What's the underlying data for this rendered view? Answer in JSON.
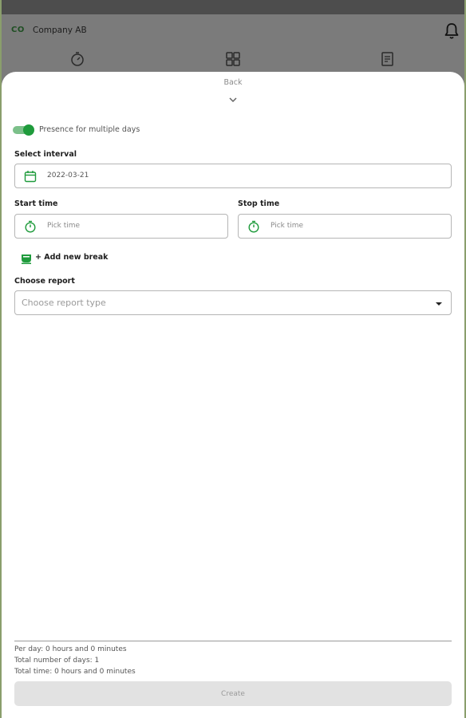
{
  "header": {
    "company_initials": "CO",
    "company_name": "Company AB",
    "nav_icons": [
      "stopwatch-icon",
      "grid-icon",
      "report-icon"
    ]
  },
  "sheet": {
    "back_label": "Back",
    "presence_toggle": {
      "label": "Presence for multiple days",
      "on": true
    },
    "interval": {
      "label": "Select interval",
      "value": "2022-03-21"
    },
    "start_time": {
      "label": "Start time",
      "placeholder": "Pick time"
    },
    "stop_time": {
      "label": "Stop time",
      "placeholder": "Pick time"
    },
    "add_break_label": "+ Add new break",
    "report": {
      "label": "Choose report",
      "placeholder": "Choose report type"
    },
    "summary": {
      "per_day": "Per day: 0 hours and 0 minutes",
      "total_days": "Total number of days: 1",
      "total_time": "Total time: 0 hours and 0 minutes"
    },
    "create_label": "Create"
  },
  "colors": {
    "accent": "#1f9b3c",
    "accent_light": "#7cc08a",
    "overlay": "#7b7b7b"
  }
}
